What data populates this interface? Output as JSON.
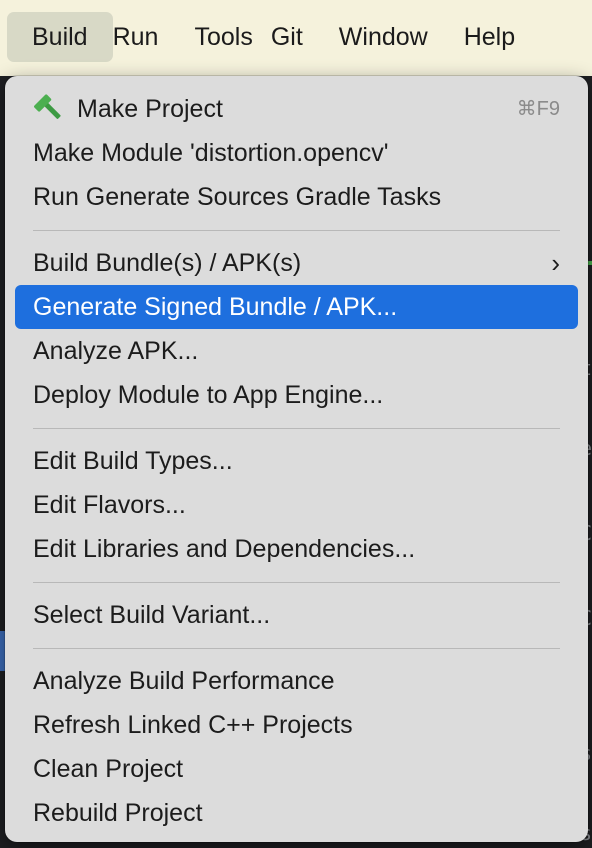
{
  "menubar": {
    "items": [
      {
        "label": "Build",
        "active": true
      },
      {
        "label": "Run"
      },
      {
        "label": "Tools"
      },
      {
        "label": "Git"
      },
      {
        "label": "Window"
      },
      {
        "label": "Help"
      }
    ]
  },
  "menu": {
    "make_project": {
      "label": "Make Project",
      "shortcut": "⌘F9",
      "icon": "hammer-icon"
    },
    "make_module": "Make Module 'distortion.opencv'",
    "run_generate_sources": "Run Generate Sources Gradle Tasks",
    "build_bundle": {
      "label": "Build Bundle(s) / APK(s)",
      "submenu_glyph": "›"
    },
    "generate_signed": "Generate Signed Bundle / APK...",
    "analyze_apk": "Analyze APK...",
    "deploy_module": "Deploy Module to App Engine...",
    "edit_build_types": "Edit Build Types...",
    "edit_flavors": "Edit Flavors...",
    "edit_libraries": "Edit Libraries and Dependencies...",
    "select_build_variant": "Select Build Variant...",
    "analyze_build_perf": "Analyze Build Performance",
    "refresh_linked": "Refresh Linked C++ Projects",
    "clean_project": "Clean Project",
    "rebuild_project": "Rebuild Project"
  },
  "colors": {
    "menubar_bg": "#f5f2dc",
    "menu_bg": "#dcdcdc",
    "selection": "#1e6fde",
    "hammer": "#4caf50"
  }
}
